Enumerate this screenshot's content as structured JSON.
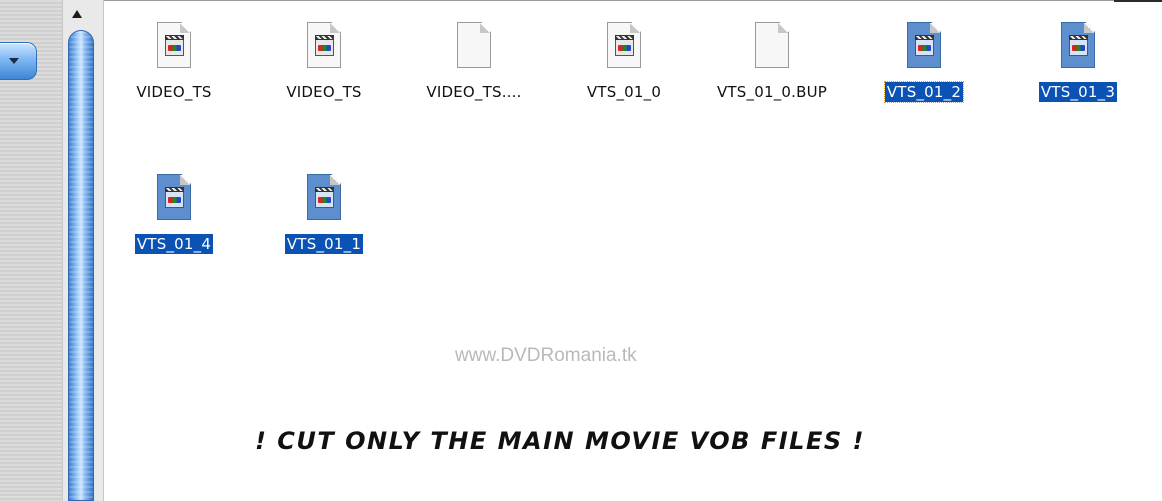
{
  "files": [
    {
      "name": "VIDEO_TS",
      "icon": "video-file-icon",
      "selected": false
    },
    {
      "name": "VIDEO_TS",
      "icon": "video-file-icon",
      "selected": false
    },
    {
      "name": "VIDEO_TS....",
      "icon": "blank-file-icon",
      "selected": false
    },
    {
      "name": "VTS_01_0",
      "icon": "video-file-icon",
      "selected": false
    },
    {
      "name": "VTS_01_0.BUP",
      "icon": "blank-file-icon",
      "selected": false
    },
    {
      "name": "VTS_01_2",
      "icon": "video-file-icon",
      "selected": true
    },
    {
      "name": "VTS_01_3",
      "icon": "video-file-icon",
      "selected": true
    },
    {
      "name": "VTS_01_4",
      "icon": "video-file-icon",
      "selected": true
    },
    {
      "name": "VTS_01_1",
      "icon": "video-file-icon",
      "selected": true
    }
  ],
  "watermark": "www.DVDRomania.tk",
  "caption": "! CUT ONLY THE MAIN MOVIE VOB FILES !",
  "colors": {
    "selection": "#0a53b4",
    "scrollbar": "#6aa6e8"
  }
}
